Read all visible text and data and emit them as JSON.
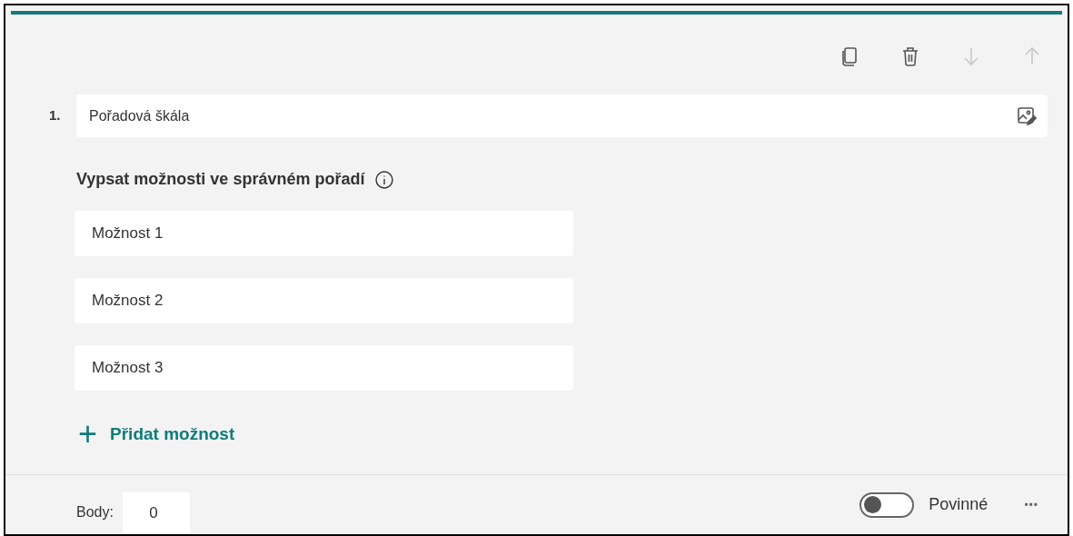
{
  "toolbar": [
    {
      "kind": "copy",
      "disabled": false
    },
    {
      "kind": "delete",
      "disabled": false
    },
    {
      "kind": "down",
      "disabled": true
    },
    {
      "kind": "up",
      "disabled": true
    }
  ],
  "question": {
    "number": "1.",
    "title": "Pořadová škála"
  },
  "instruction": "Vypsat možnosti ve správném pořadí",
  "options": [
    "Možnost 1",
    "Možnost 2",
    "Možnost 3"
  ],
  "add_option": {
    "icon": "+",
    "label": "Přidat možnost"
  },
  "footer": {
    "points_label": "Body:",
    "points_value": "0",
    "required": {
      "label": "Povinné",
      "on": false
    },
    "more": "•••"
  }
}
